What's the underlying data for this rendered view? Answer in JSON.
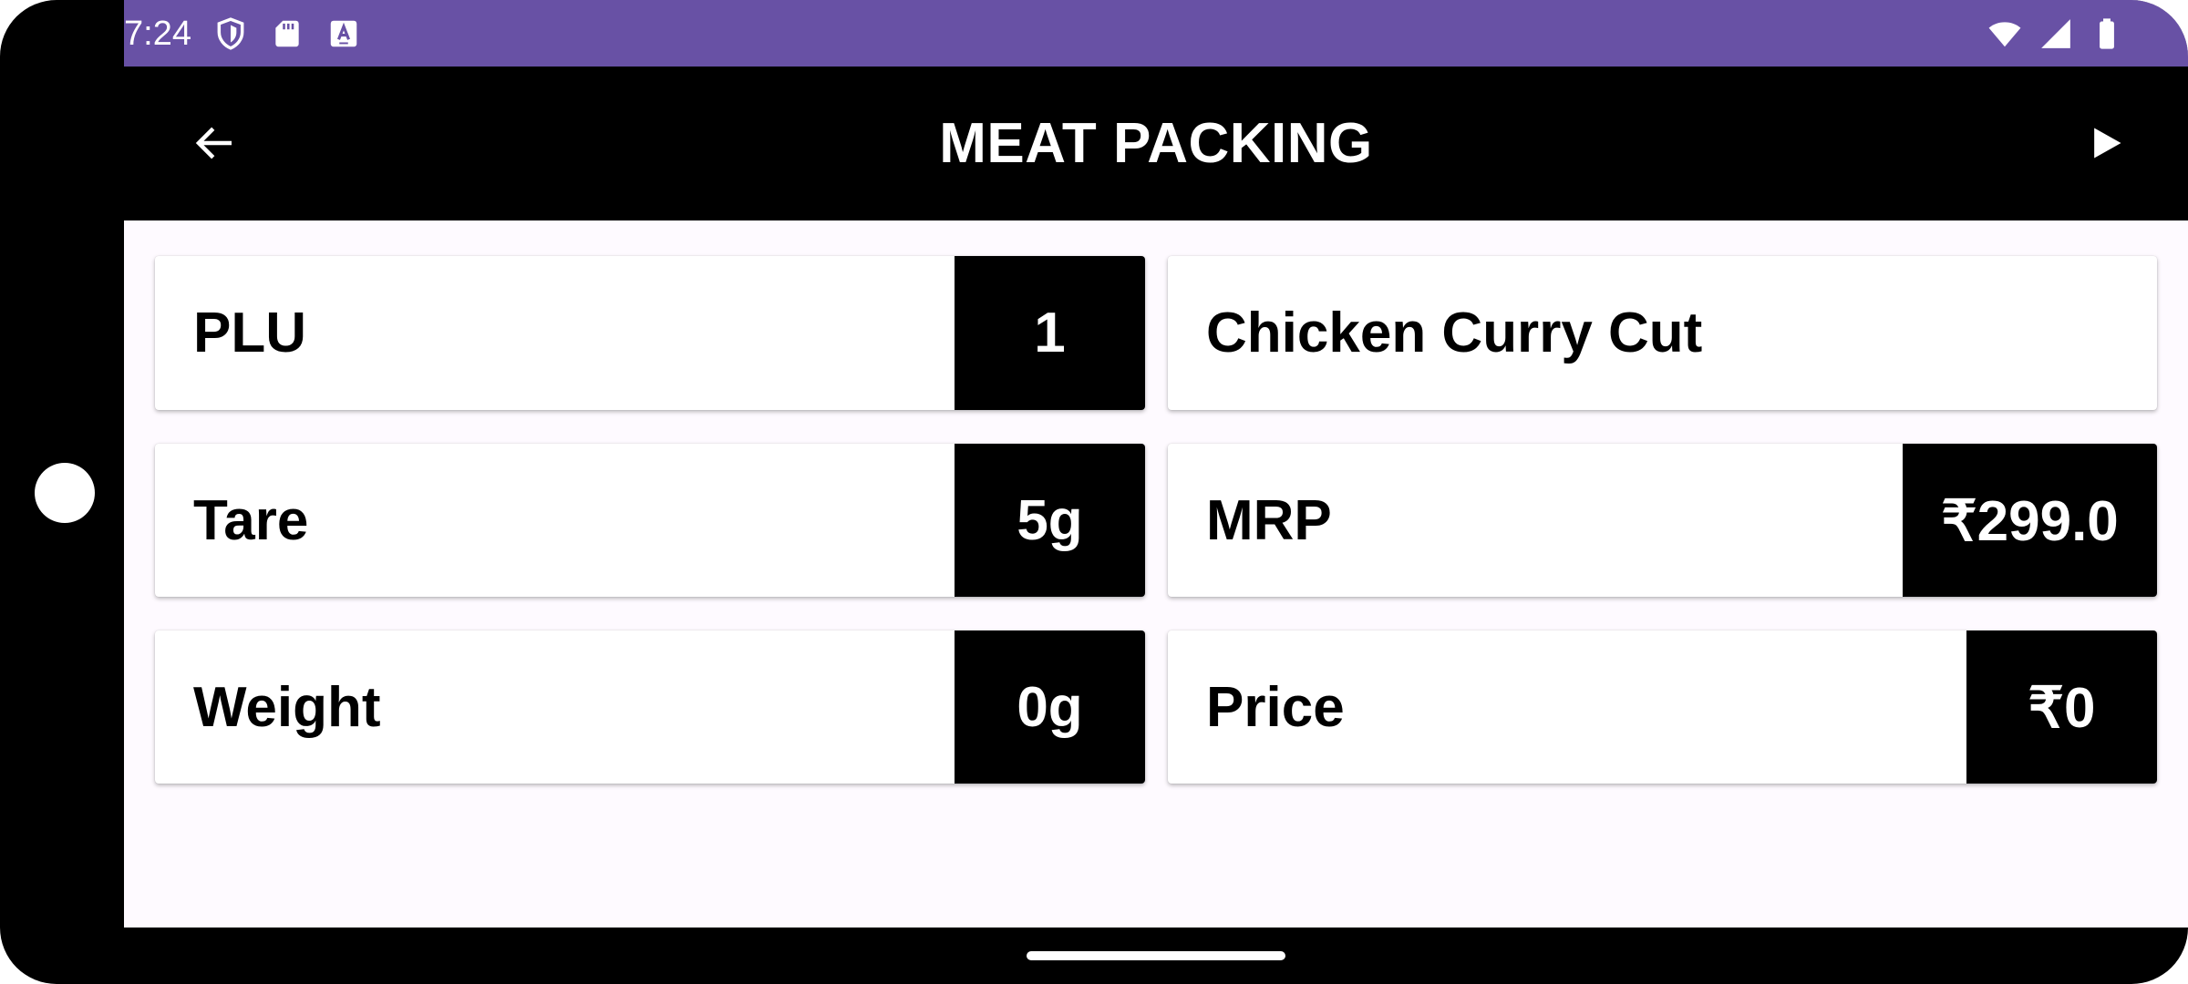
{
  "status_bar": {
    "time": "7:24",
    "left_icons": [
      "shield-icon",
      "sd-card-icon",
      "keyboard-a-icon"
    ],
    "right_icons": [
      "wifi-icon",
      "signal-icon",
      "battery-icon"
    ],
    "color": "#6851a5"
  },
  "app_bar": {
    "title": "MEAT PACKING",
    "back_icon": "arrow-left-icon",
    "action_icon": "play-icon"
  },
  "fields": {
    "plu": {
      "label": "PLU",
      "value": "1"
    },
    "product": {
      "name": "Chicken Curry Cut"
    },
    "tare": {
      "label": "Tare",
      "value": "5g"
    },
    "mrp": {
      "label": "MRP",
      "value": "₹299.0"
    },
    "weight": {
      "label": "Weight",
      "value": "0g"
    },
    "price": {
      "label": "Price",
      "value": "₹0"
    }
  }
}
